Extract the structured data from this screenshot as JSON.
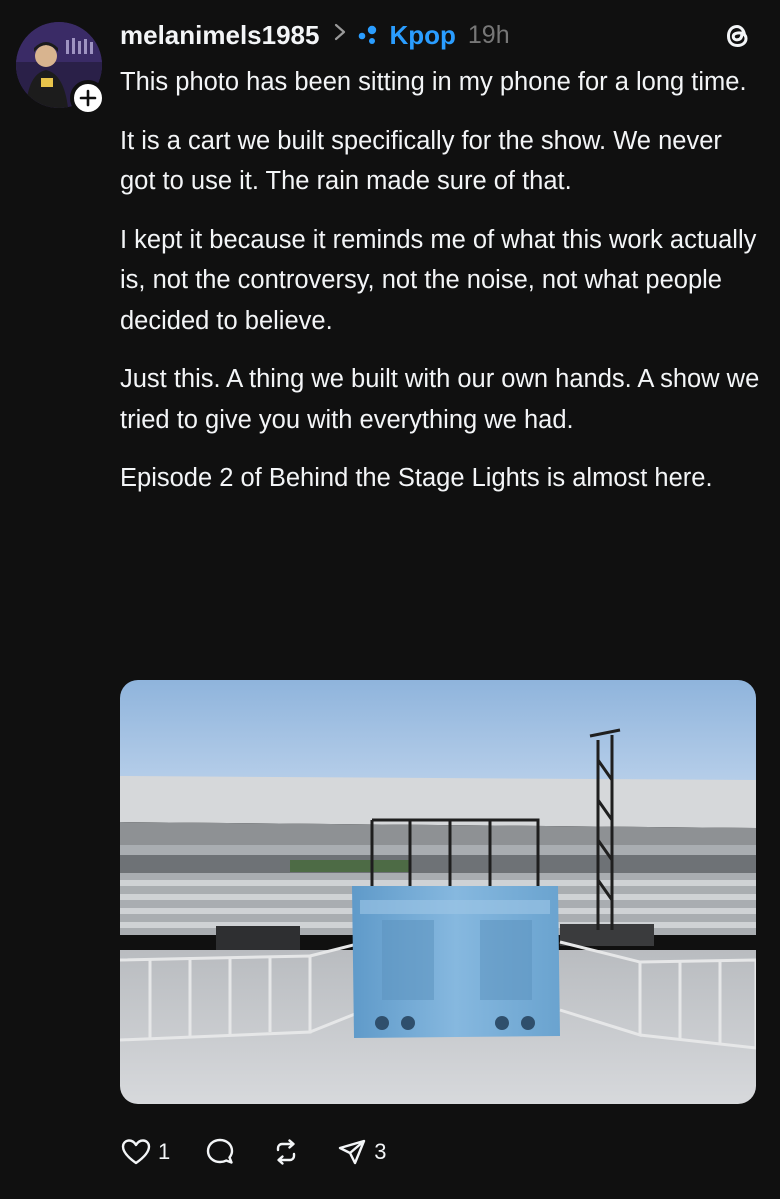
{
  "post": {
    "username": "melanimels1985",
    "topic": "Kpop",
    "time": "19h",
    "paragraphs": [
      "This photo has been sitting in my phone for a long time.",
      "It is a cart we built specifically for the show. We never got to use it. The rain made sure of that.",
      "I kept it because it reminds me of what this work actually is, not the controversy, not the noise, not what people decided to believe.",
      "Just this. A thing we built with our own hands. A show we tried to give you with everything we had.",
      "Episode 2 of Behind the Stage Lights is almost here."
    ],
    "likes": "1",
    "shares": "3"
  },
  "icons": {
    "avatar": "profile-avatar",
    "follow": "plus-icon",
    "chevron": "chevron-right-icon",
    "topic": "topic-dots-icon",
    "app_logo": "threads-logo-icon",
    "like": "heart-icon",
    "comment": "comment-icon",
    "repost": "repost-icon",
    "share": "send-icon"
  },
  "colors": {
    "background": "#101010",
    "text": "#f3f5f7",
    "topic": "#2a9dff",
    "muted": "#777777"
  }
}
